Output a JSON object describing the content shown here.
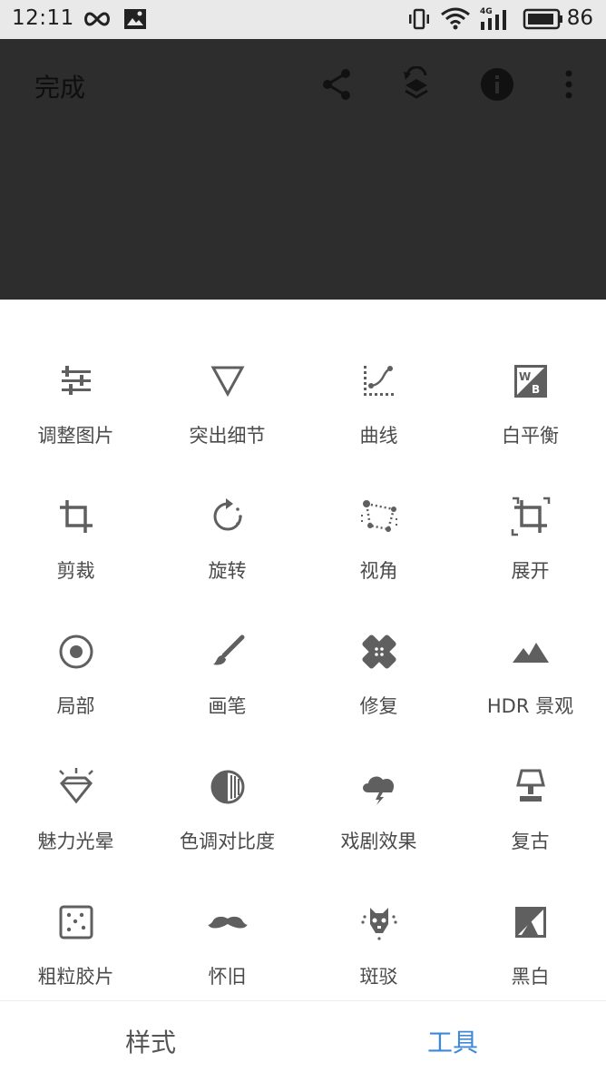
{
  "status_bar": {
    "time": "12:11",
    "battery_percent": "86",
    "network": "4G"
  },
  "header": {
    "done_label": "完成",
    "icons": [
      "share-icon",
      "undo-stack-icon",
      "info-icon",
      "more-icon"
    ]
  },
  "tools": [
    {
      "label": "调整图片",
      "icon": "tune-sliders-icon"
    },
    {
      "label": "突出细节",
      "icon": "details-triangle-icon"
    },
    {
      "label": "曲线",
      "icon": "curves-icon"
    },
    {
      "label": "白平衡",
      "icon": "white-balance-icon"
    },
    {
      "label": "剪裁",
      "icon": "crop-icon"
    },
    {
      "label": "旋转",
      "icon": "rotate-icon"
    },
    {
      "label": "视角",
      "icon": "perspective-icon"
    },
    {
      "label": "展开",
      "icon": "expand-icon"
    },
    {
      "label": "局部",
      "icon": "selective-icon"
    },
    {
      "label": "画笔",
      "icon": "brush-icon"
    },
    {
      "label": "修复",
      "icon": "healing-bandage-icon"
    },
    {
      "label": "HDR 景观",
      "icon": "hdr-mountain-icon"
    },
    {
      "label": "魅力光晕",
      "icon": "glamour-glow-icon"
    },
    {
      "label": "色调对比度",
      "icon": "tonal-contrast-icon"
    },
    {
      "label": "戏剧效果",
      "icon": "drama-cloud-icon"
    },
    {
      "label": "复古",
      "icon": "vintage-lamp-icon"
    },
    {
      "label": "粗粒胶片",
      "icon": "grainy-film-icon"
    },
    {
      "label": "怀旧",
      "icon": "retrolux-mustache-icon"
    },
    {
      "label": "斑驳",
      "icon": "grunge-icon"
    },
    {
      "label": "黑白",
      "icon": "black-white-icon"
    }
  ],
  "bottom_tabs": {
    "styles_label": "样式",
    "tools_label": "工具",
    "active_color": "#3f88d6"
  }
}
